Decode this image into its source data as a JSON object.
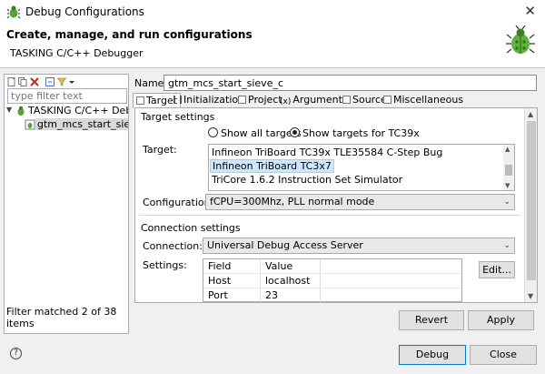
{
  "window": {
    "title": "Debug Configurations",
    "app_icon": "debug-bug-icon",
    "close_icon": "close-icon"
  },
  "header": {
    "title": "Create, manage, and run configurations",
    "subtitle": "TASKING C/C++ Debugger",
    "banner_icon": "debug-bug-icon"
  },
  "left": {
    "toolbar_icons": [
      "new-config-icon",
      "duplicate-config-icon",
      "delete-icon",
      "collapse-all-icon",
      "filter-icon",
      "dropdown-arrow-icon"
    ],
    "filter_placeholder": "type filter text",
    "tree": {
      "parent": "TASKING C/C++ Debug",
      "child": "gtm_mcs_start_sieve_c"
    },
    "status": "Filter matched 2 of 38 items"
  },
  "name": {
    "label": "Name:",
    "value": "gtm_mcs_start_sieve_c"
  },
  "tabs": [
    "Target",
    "Initialization",
    "Project",
    "Arguments",
    "Source",
    "Miscellaneous"
  ],
  "target_settings": {
    "title": "Target settings",
    "radio_all": "Show all targets",
    "radio_for": "Show targets for TC39x",
    "target_label": "Target:",
    "targets": [
      "Infineon TriBoard TC39x TLE35584 C-Step Bug",
      "Infineon TriBoard TC3x7",
      "TriCore 1.6.2 Instruction Set Simulator"
    ],
    "selected_target": "Infineon TriBoard TC3x7",
    "config_label": "Configuration:",
    "config_value": "fCPU=300Mhz, PLL normal mode"
  },
  "connection": {
    "title": "Connection settings",
    "conn_label": "Connection:",
    "conn_value": "Universal Debug Access Server",
    "settings_label": "Settings:",
    "columns": [
      "Field",
      "Value"
    ],
    "rows": [
      [
        "Host",
        "localhost"
      ],
      [
        "Port",
        "23"
      ]
    ],
    "edit_button": "Edit..."
  },
  "buttons": {
    "revert": "Revert",
    "apply": "Apply",
    "debug": "Debug",
    "close": "Close"
  },
  "help_icon": "help-icon"
}
